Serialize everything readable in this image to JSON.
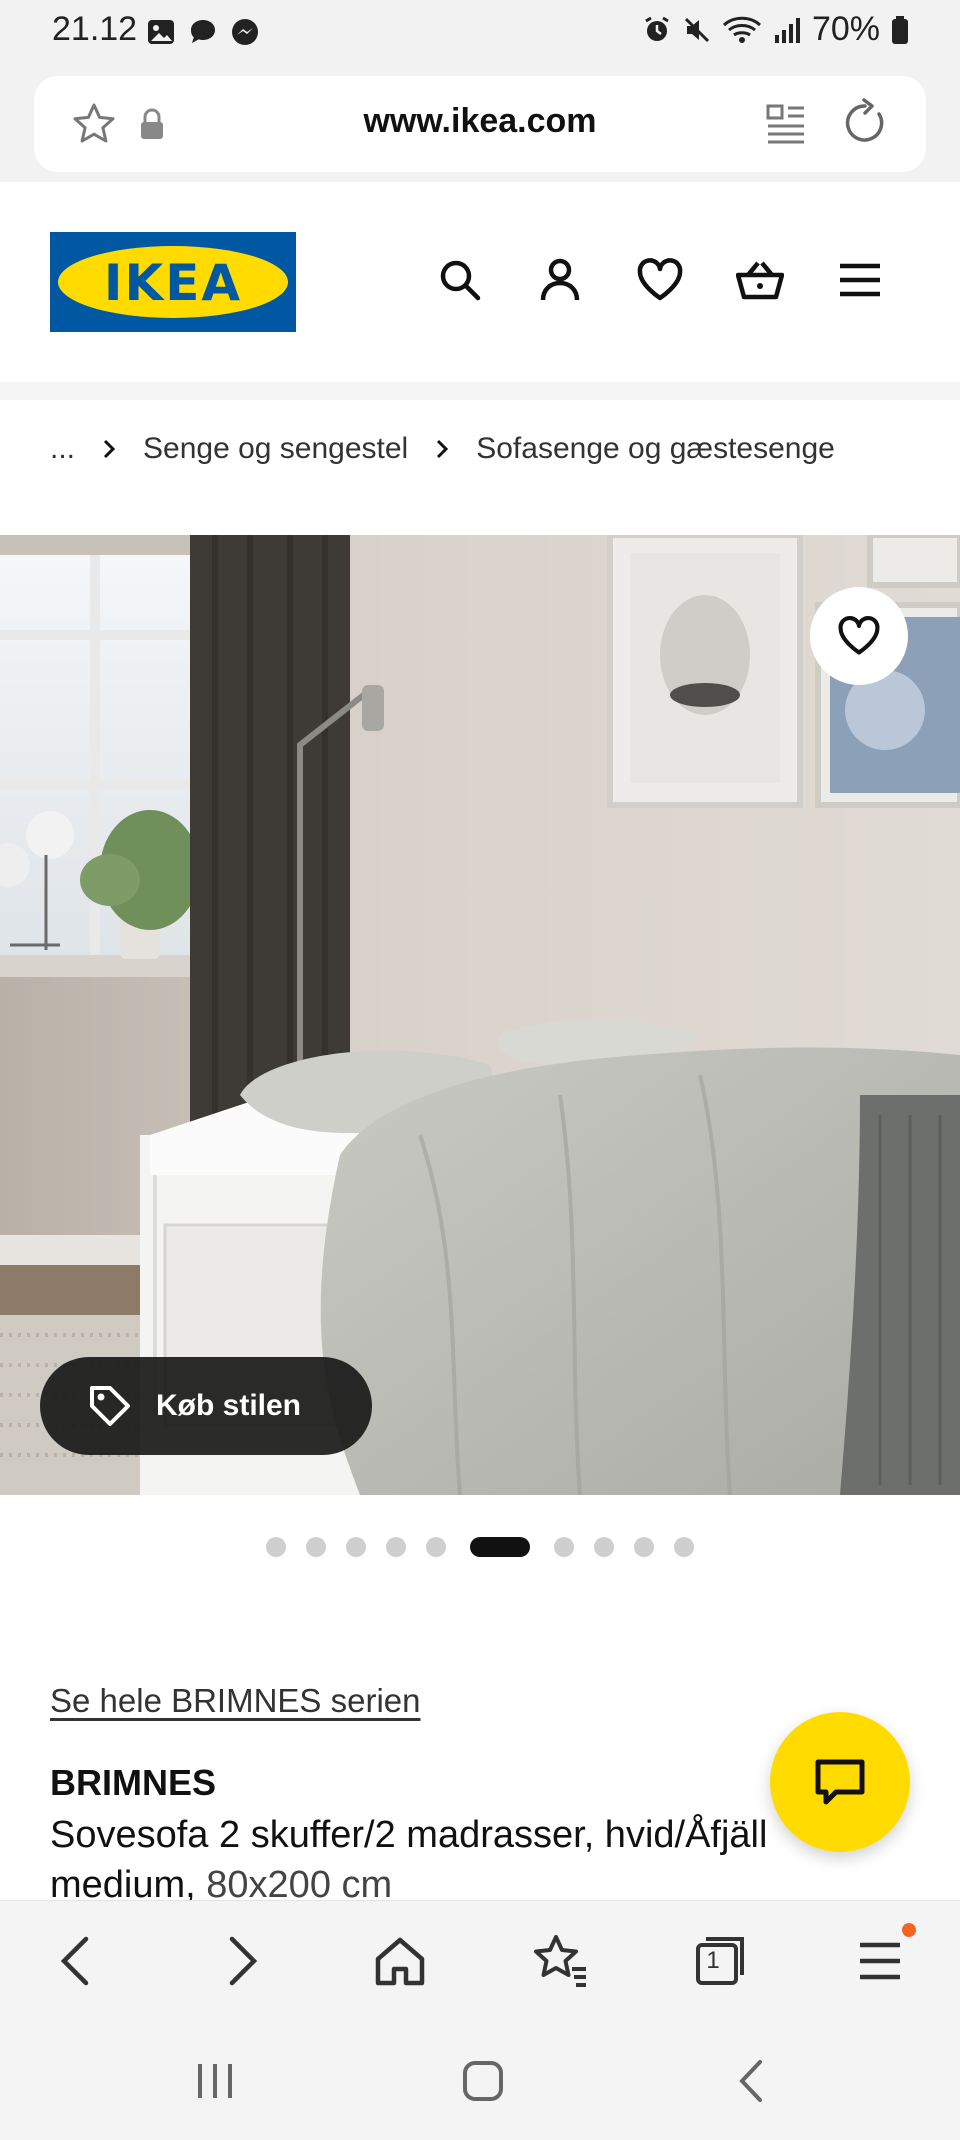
{
  "status_bar": {
    "time": "21.12",
    "battery": "70%",
    "icons_left": [
      "image-icon",
      "chat-bubble-icon",
      "messenger-icon"
    ],
    "icons_right": [
      "alarm-icon",
      "mute-icon",
      "wifi-icon",
      "signal-icon",
      "battery-icon"
    ]
  },
  "browser": {
    "url": "www.ikea.com",
    "bottom_nav": [
      "back-icon",
      "forward-icon",
      "home-icon",
      "bookmarks-icon",
      "tabs-icon",
      "menu-icon"
    ],
    "tab_count": "1"
  },
  "header": {
    "logo_text": "IKEA",
    "icons": [
      "search-icon",
      "account-icon",
      "wishlist-heart-icon",
      "cart-basket-icon",
      "hamburger-menu-icon"
    ]
  },
  "breadcrumb": {
    "ellipsis": "...",
    "items": [
      "Senge og sengestel",
      "Sofasenge og gæstesenge"
    ]
  },
  "hero": {
    "shop_style_label": "Køb stilen",
    "image_count": 10,
    "active_index": 5
  },
  "product": {
    "series_link": "Se hele BRIMNES serien",
    "name": "BRIMNES",
    "description": "Sovesofa 2 skuffer/2 madrasser, hvid/Åfjäll medium,",
    "size": "80x200 cm"
  },
  "colors": {
    "ikea_blue": "#0058a3",
    "ikea_yellow": "#ffdb00",
    "notification_dot": "#f26522"
  }
}
